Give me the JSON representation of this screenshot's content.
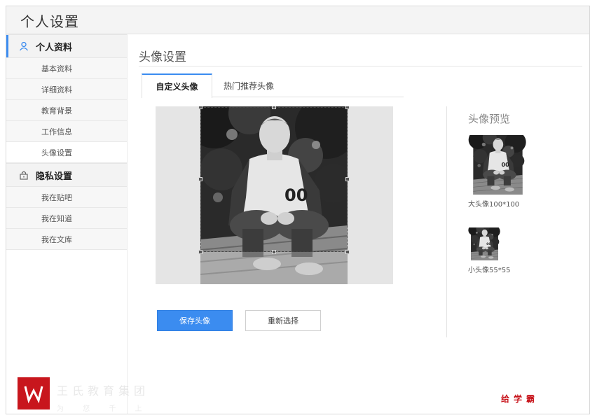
{
  "app": {
    "title": "个人设置"
  },
  "sidebar": {
    "sections": [
      {
        "label": "个人资料",
        "icon": "user-icon",
        "items": [
          "基本资料",
          "详细资料",
          "教育背景",
          "工作信息",
          "头像设置"
        ]
      },
      {
        "label": "隐私设置",
        "icon": "lock-icon",
        "items": [
          "我在贴吧",
          "我在知道",
          "我在文库"
        ]
      }
    ],
    "selected_item": "头像设置"
  },
  "main": {
    "title": "头像设置",
    "tabs": [
      {
        "label": "自定义头像",
        "active": true
      },
      {
        "label": "热门推荐头像",
        "active": false
      }
    ],
    "preview": {
      "title": "头像预览",
      "large_label": "大头像100*100",
      "small_label": "小头像55*55"
    },
    "buttons": {
      "save": "保存头像",
      "reselect": "重新选择"
    }
  },
  "watermark": {
    "text": "王氏教育集团",
    "sub": "为 您 千 上",
    "brand": "给学霸"
  },
  "colors": {
    "accent": "#3b8cf0",
    "brand_red": "#c8161d"
  }
}
